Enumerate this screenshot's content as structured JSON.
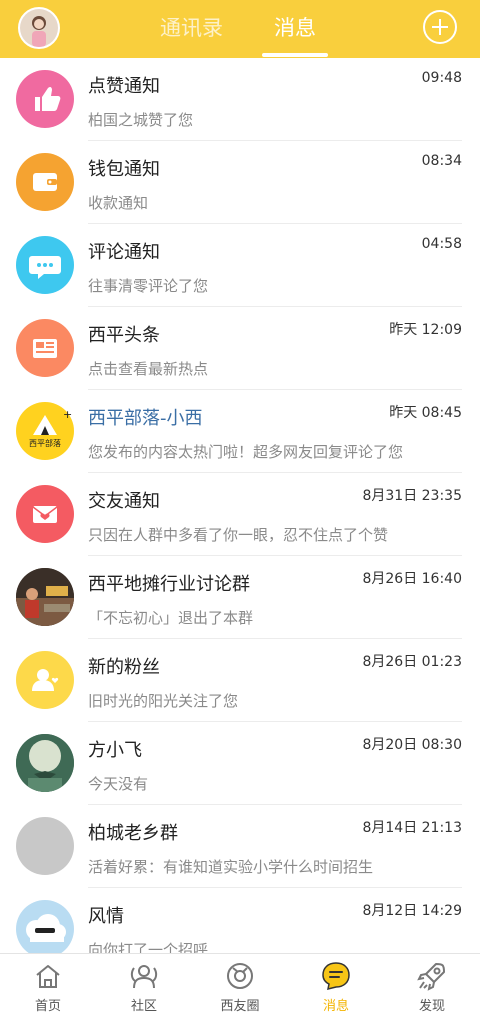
{
  "header": {
    "tabs": [
      {
        "label": "通讯录",
        "active": false
      },
      {
        "label": "消息",
        "active": true
      }
    ],
    "add_icon": "plus-circle-icon",
    "accent_color": "#f9cf3d"
  },
  "messages": [
    {
      "title": "点赞通知",
      "time": "09:48",
      "preview": "柏国之城赞了您",
      "icon": "thumbs-up-icon",
      "icon_color": "#f06aa0"
    },
    {
      "title": "钱包通知",
      "time": "08:34",
      "preview": "收款通知",
      "icon": "wallet-icon",
      "icon_color": "#f5a331"
    },
    {
      "title": "评论通知",
      "time": "04:58",
      "preview": "往事清零评论了您",
      "icon": "comment-icon",
      "icon_color": "#3ec8ef"
    },
    {
      "title": "西平头条",
      "time": "昨天 12:09",
      "preview": "点击查看最新热点",
      "icon": "newspaper-icon",
      "icon_color": "#fb8962"
    },
    {
      "title": "西平部落-小西",
      "time": "昨天 08:45",
      "preview": "您发布的内容太热门啦！超多网友回复评论了您",
      "icon": "tribe-logo-icon",
      "icon_color": "#ffd21f",
      "badge_text": "西平部落"
    },
    {
      "title": "交友通知",
      "time": "8月31日 23:35",
      "preview": "只因在人群中多看了你一眼，忍不住点了个赞",
      "icon": "envelope-heart-icon",
      "icon_color": "#f45b62"
    },
    {
      "title": "西平地摊行业讨论群",
      "time": "8月26日 16:40",
      "preview": "「不忘初心」退出了本群",
      "icon": "group-photo-icon",
      "icon_color": "#5a4a3a"
    },
    {
      "title": "新的粉丝",
      "time": "8月26日 01:23",
      "preview": "旧时光的阳光关注了您",
      "icon": "fan-user-icon",
      "icon_color": "#fdd94a"
    },
    {
      "title": "方小飞",
      "time": "8月20日 08:30",
      "preview": "今天没有",
      "icon": "user-photo-icon",
      "icon_color": "#4f7d66"
    },
    {
      "title": "柏城老乡群",
      "time": "8月14日 21:13",
      "preview": "活着好累：有谁知道实验小学什么时间招生",
      "icon": "group-placeholder-icon",
      "icon_color": "#c8c8c8"
    },
    {
      "title": "风情",
      "time": "8月12日 14:29",
      "preview": "向你打了一个招呼",
      "icon": "cloud-avatar-icon",
      "icon_color": "#b9dcf2"
    }
  ],
  "tabbar": [
    {
      "label": "首页",
      "icon": "home-icon",
      "active": false
    },
    {
      "label": "社区",
      "icon": "community-icon",
      "active": false
    },
    {
      "label": "西友圈",
      "icon": "moments-icon",
      "active": false
    },
    {
      "label": "消息",
      "icon": "message-icon",
      "active": true
    },
    {
      "label": "发现",
      "icon": "rocket-icon",
      "active": false
    }
  ],
  "colors": {
    "active_tab": "#f4b400",
    "link_title": "#3a6ea5"
  }
}
